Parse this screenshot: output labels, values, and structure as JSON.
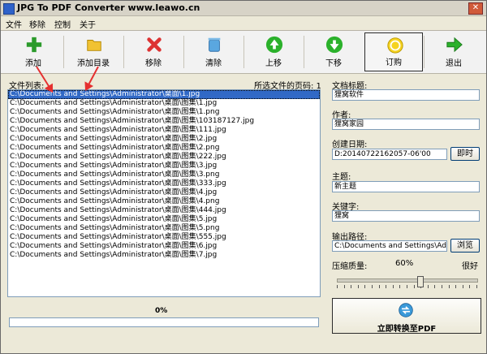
{
  "window": {
    "title": "JPG To PDF Converter  www.leawo.cn",
    "close": "✕"
  },
  "menu": [
    "文件",
    "移除",
    "控制",
    "关于"
  ],
  "toolbar": [
    {
      "label": "添加",
      "icon": "plus-icon"
    },
    {
      "label": "添加目录",
      "icon": "folder-icon"
    },
    {
      "label": "移除",
      "icon": "remove-icon"
    },
    {
      "label": "清除",
      "icon": "trash-icon"
    },
    {
      "label": "上移",
      "icon": "up-arrow-icon"
    },
    {
      "label": "下移",
      "icon": "down-arrow-icon"
    },
    {
      "label": "订购",
      "icon": "coin-icon"
    },
    {
      "label": "退出",
      "icon": "exit-icon"
    }
  ],
  "left": {
    "file_list_label": "文件列表:",
    "page_label": "所选文件的页码: 1",
    "files": [
      "C:\\Documents and Settings\\Administrator\\桌面\\1.jpg",
      "C:\\Documents and Settings\\Administrator\\桌面\\图集\\1.jpg",
      "C:\\Documents and Settings\\Administrator\\桌面\\图集\\1.png",
      "C:\\Documents and Settings\\Administrator\\桌面\\图集\\103187127.jpg",
      "C:\\Documents and Settings\\Administrator\\桌面\\图集\\111.jpg",
      "C:\\Documents and Settings\\Administrator\\桌面\\图集\\2.jpg",
      "C:\\Documents and Settings\\Administrator\\桌面\\图集\\2.png",
      "C:\\Documents and Settings\\Administrator\\桌面\\图集\\222.jpg",
      "C:\\Documents and Settings\\Administrator\\桌面\\图集\\3.jpg",
      "C:\\Documents and Settings\\Administrator\\桌面\\图集\\3.png",
      "C:\\Documents and Settings\\Administrator\\桌面\\图集\\333.jpg",
      "C:\\Documents and Settings\\Administrator\\桌面\\图集\\4.jpg",
      "C:\\Documents and Settings\\Administrator\\桌面\\图集\\4.png",
      "C:\\Documents and Settings\\Administrator\\桌面\\图集\\444.jpg",
      "C:\\Documents and Settings\\Administrator\\桌面\\图集\\5.jpg",
      "C:\\Documents and Settings\\Administrator\\桌面\\图集\\5.png",
      "C:\\Documents and Settings\\Administrator\\桌面\\图集\\555.jpg",
      "C:\\Documents and Settings\\Administrator\\桌面\\图集\\6.jpg",
      "C:\\Documents and Settings\\Administrator\\桌面\\图集\\7.jpg"
    ],
    "progress_text": "0%",
    "progress_value": 0
  },
  "right": {
    "doc_title_label": "文档标题:",
    "doc_title_value": "狸窝软件",
    "author_label": "作者:",
    "author_value": "狸窝家园",
    "created_label": "创建日期:",
    "created_value": "D:20140722162057-06'00",
    "now_button": "即时",
    "subject_label": "主题:",
    "subject_value": "新主题",
    "keywords_label": "关键字:",
    "keywords_value": "狸窝",
    "output_label": "输出路径:",
    "output_value": "C:\\Documents and Settings\\Ad",
    "browse_button": "浏览",
    "quality_label": "压缩质量:",
    "quality_value": "60%",
    "quality_max": "很好",
    "quality_fraction": 0.6,
    "convert_button": "立即转换至PDF"
  }
}
